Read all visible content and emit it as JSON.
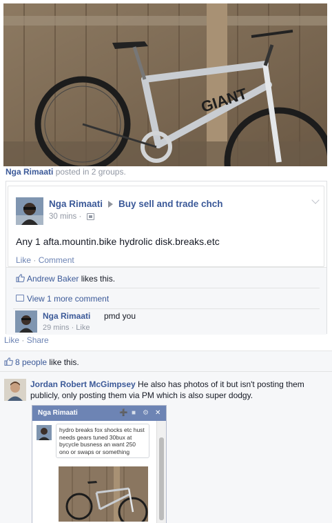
{
  "shared_post": {
    "author": "Nga Rimaati",
    "shared_suffix": "posted in 2 groups."
  },
  "inner_post": {
    "author": "Nga Rimaati",
    "group": "Buy sell and trade chch",
    "time": "30 mins ·",
    "body": "Any 1 afta.mountin.bike hydrolic disk.breaks.etc",
    "like": "Like",
    "separator": " · ",
    "comment": "Comment",
    "liker": "Andrew Baker",
    "likes_suffix": " likes this.",
    "view_more": "View 1 more comment",
    "comment_author": "Nga Rimaati",
    "comment_text": "pmd you",
    "comment_meta": "29 mins · Like"
  },
  "outer_post": {
    "like": "Like",
    "separator": " · ",
    "share": "Share",
    "people_count": "8 people",
    "likes_suffix": " like this.",
    "comment_author": "Jordan Robert McGimpsey",
    "comment_text": " He also has photos of it but isn't posting them publicly, only posting them via PM which is also super dodgy."
  },
  "chat_window": {
    "title": "Nga Rimaati",
    "message": "hydro breaks fox shocks etc hust needs gears tuned 30bux at bycycle busness an want 250 ono or swaps or something"
  },
  "colors": {
    "link": "#3b5998",
    "chat_header": "#6d84b4",
    "muted": "#9197a3"
  }
}
